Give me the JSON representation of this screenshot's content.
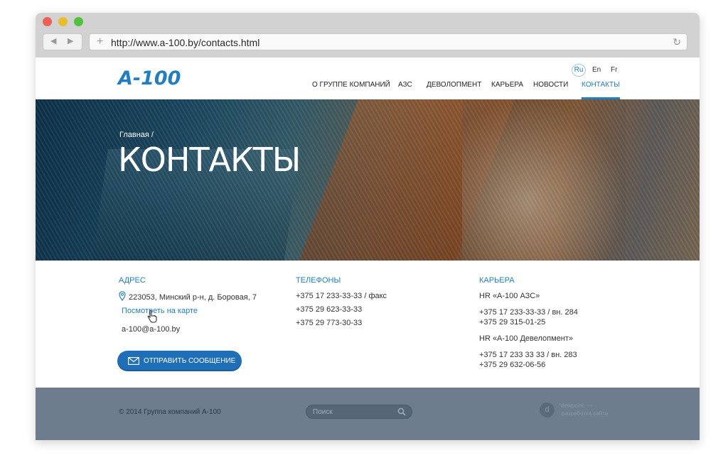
{
  "browser": {
    "url": "http://www.a-100.by/contacts.html"
  },
  "header": {
    "logo": "A-100",
    "languages": [
      "Ru",
      "En",
      "Fr"
    ],
    "menu": [
      {
        "label": "О ГРУППЕ КОМПАНИЙ"
      },
      {
        "label": "АЗС"
      },
      {
        "label": "ДЕВОЛОПМЕНТ"
      },
      {
        "label": "КАРЬЕРА"
      },
      {
        "label": "НОВОСТИ"
      },
      {
        "label": "КОНТАКТЫ"
      }
    ],
    "active_menu": "КОНТАКТЫ"
  },
  "hero": {
    "breadcrumb": "Главная  /",
    "title": "КОНТАКТЫ"
  },
  "address": {
    "heading": "АДРЕС",
    "address_line": "223053, Минский р-н, д. Боровая, 7",
    "map_link": "Посмотреть на карте",
    "email": "a-100@a-100.by",
    "send_button": "ОТПРАВИТЬ СООБЩЕНИЕ"
  },
  "phones": {
    "heading": "ТЕЛЕФОНЫ",
    "lines": [
      "+375 17 233-33-33 / факс",
      "+375 29 623-33-33",
      "+375 29 773-30-33"
    ]
  },
  "career": {
    "heading": "КАРЬЕРА",
    "hr1": "HR «А-100 АЗС»",
    "hr1_phone1": "+375 17 233-33-33  /  вн. 284",
    "hr1_phone2": "+375 29 315-01-25",
    "hr2": "HR «А-100 Девелопмент»",
    "hr2_phone1": "+375 17 233 33 33  /  вн. 283",
    "hr2_phone2": "+375 29 632-06-56"
  },
  "footer": {
    "copyright": "© 2014 Группа компаний А-100",
    "search_placeholder": "Поиск",
    "dev_name": "*dewpoint: —",
    "dev_sub": "разработка сайта"
  },
  "colors": {
    "accent": "#1f7fc2",
    "footer_bg": "#6e7d8e"
  }
}
